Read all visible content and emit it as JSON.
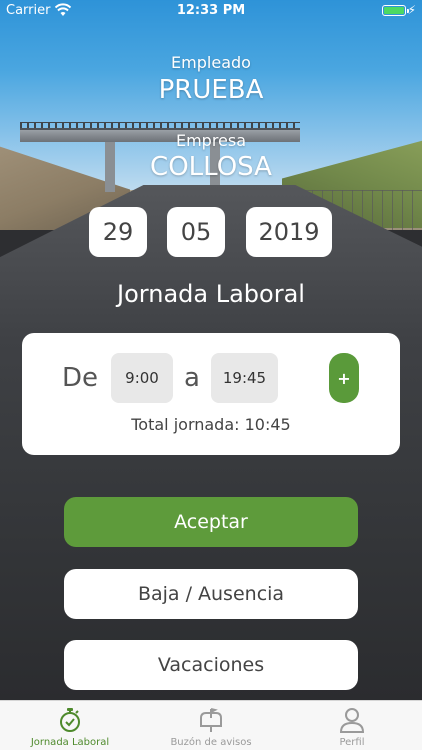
{
  "status_bar": {
    "carrier": "Carrier",
    "time": "12:33 PM"
  },
  "header": {
    "employee_label": "Empleado",
    "employee_value": "PRUEBA",
    "company_label": "Empresa",
    "company_value": "COLLOSA"
  },
  "date": {
    "day": "29",
    "month": "05",
    "year": "2019"
  },
  "section_title": "Jornada Laboral",
  "shift": {
    "from_label": "De",
    "from_value": "9:00",
    "to_label": "a",
    "to_value": "19:45",
    "add_label": "+",
    "total": "Total jornada: 10:45"
  },
  "buttons": {
    "accept": "Aceptar",
    "leave": "Baja / Ausencia",
    "vacation": "Vacaciones"
  },
  "tabs": [
    {
      "label": "Jornada Laboral",
      "icon": "stopwatch-check-icon",
      "active": true
    },
    {
      "label": "Buzón de avisos",
      "icon": "mailbox-icon",
      "active": false
    },
    {
      "label": "Perfil",
      "icon": "user-icon",
      "active": false
    }
  ],
  "colors": {
    "accent_green": "#5e9b3b",
    "tab_active": "#4e8a2c",
    "tab_inactive": "#9a9a9a"
  }
}
